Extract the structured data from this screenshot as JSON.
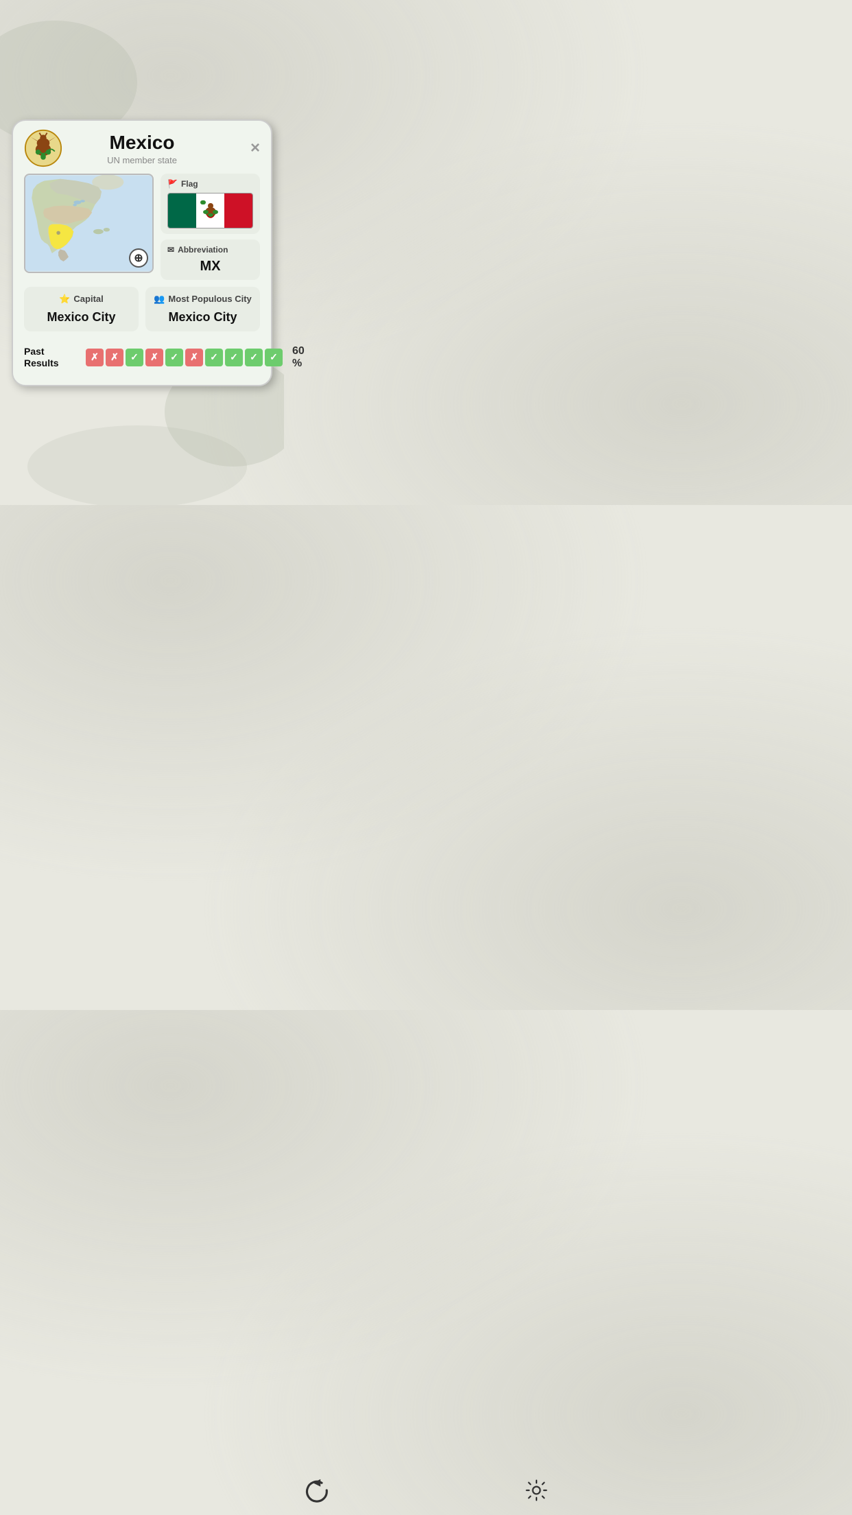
{
  "country": {
    "name": "Mexico",
    "status": "UN member state",
    "abbreviation": "MX"
  },
  "header": {
    "close_label": "×"
  },
  "flag_panel": {
    "label": "Flag",
    "icon": "🚩"
  },
  "abbrev_panel": {
    "label": "Abbreviation",
    "icon": "✉"
  },
  "capital_card": {
    "label": "Capital",
    "icon": "⭐",
    "value": "Mexico City"
  },
  "populous_card": {
    "label": "Most Populous City",
    "icon": "👥",
    "value": "Mexico City"
  },
  "past_results": {
    "label": "Past\nResults",
    "percent": "60 %",
    "boxes": [
      "wrong",
      "wrong",
      "correct",
      "wrong",
      "correct",
      "wrong",
      "correct",
      "correct",
      "correct",
      "correct"
    ]
  },
  "bottom_bar": {
    "back_icon": "back-icon",
    "settings_icon": "settings-icon"
  }
}
